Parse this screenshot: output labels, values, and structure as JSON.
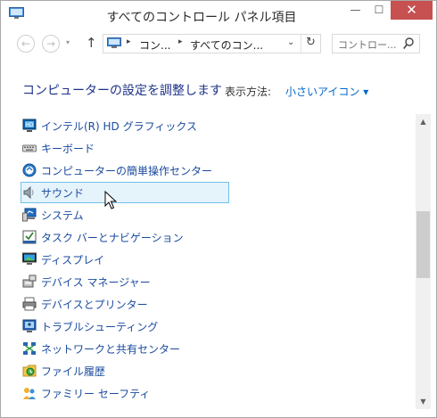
{
  "window": {
    "title": "すべてのコントロール パネル項目",
    "minimize_label": "—",
    "maximize_label": "☐",
    "close_label": "✕"
  },
  "nav": {
    "back_label": "←",
    "forward_label": "→",
    "recent_label": "▾",
    "up_label": "↑"
  },
  "address": {
    "sep1": "▸",
    "crumb1": "コン...",
    "sep2": "▸",
    "crumb2": "すべてのコン...",
    "dropdown_label": "⌄",
    "refresh_label": "↻"
  },
  "search": {
    "placeholder": "コントロー..."
  },
  "header": {
    "title": "コンピューターの設定を調整します",
    "view_by_label": "表示方法:",
    "view_by_value": "小さいアイコン ▾"
  },
  "items": [
    {
      "label": "インテル(R) HD グラフィックス",
      "icon": "intel-graphics-icon"
    },
    {
      "label": "キーボード",
      "icon": "keyboard-icon"
    },
    {
      "label": "コンピューターの簡単操作センター",
      "icon": "ease-of-access-icon"
    },
    {
      "label": "サウンド",
      "icon": "speaker-icon"
    },
    {
      "label": "システム",
      "icon": "system-icon"
    },
    {
      "label": "タスク バーとナビゲーション",
      "icon": "taskbar-icon"
    },
    {
      "label": "ディスプレイ",
      "icon": "display-icon"
    },
    {
      "label": "デバイス マネージャー",
      "icon": "device-manager-icon"
    },
    {
      "label": "デバイスとプリンター",
      "icon": "printer-icon"
    },
    {
      "label": "トラブルシューティング",
      "icon": "troubleshooting-icon"
    },
    {
      "label": "ネットワークと共有センター",
      "icon": "network-icon"
    },
    {
      "label": "ファイル履歴",
      "icon": "file-history-icon"
    },
    {
      "label": "ファミリー セーフティ",
      "icon": "family-safety-icon"
    }
  ],
  "scrollbar": {
    "up_label": "▲",
    "down_label": "▼",
    "position_fraction": 0.33
  },
  "colors": {
    "link": "#1a4a9e",
    "header": "#1e3287",
    "hover_bg": "#e5f3fb",
    "hover_border": "#70c0e7",
    "close_button": "#c75050"
  }
}
